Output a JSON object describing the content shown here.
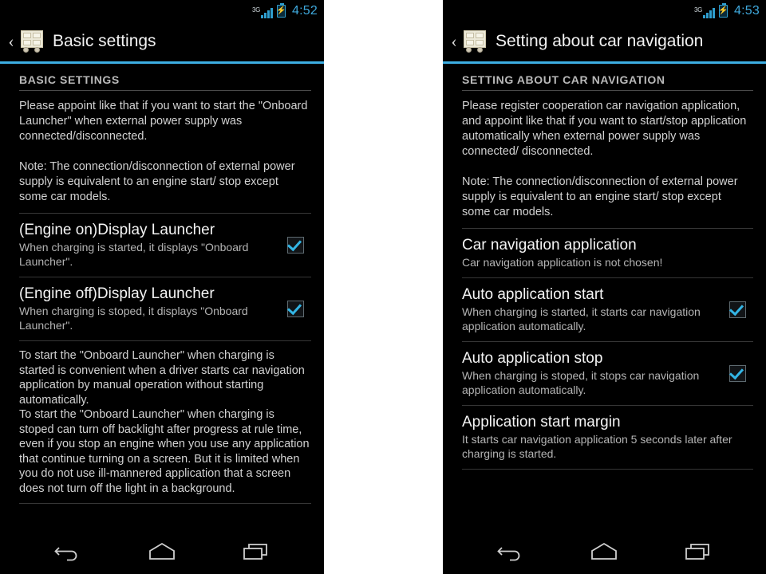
{
  "screens": [
    {
      "id": "basic-settings",
      "status_bar": {
        "network_label": "3G",
        "signal_icon": "signal-bars-icon",
        "battery_icon": "battery-charging-icon",
        "clock": "4:52"
      },
      "action_bar": {
        "up_caret": "‹",
        "app_icon": "onboard-launcher-cart-icon",
        "title": "Basic settings"
      },
      "section_header": "BASIC SETTINGS",
      "intro_paragraph": "Please appoint like that if you want to start the \"Onboard Launcher\" when external power supply was connected/disconnected.\n\nNote: The connection/disconnection of external power supply is equivalent to an engine start/ stop except some car models.",
      "preferences": [
        {
          "title": "(Engine on)Display Launcher",
          "summary": "When charging is started, it displays \"Onboard Launcher\".",
          "widget": "checkbox",
          "checked": true
        },
        {
          "title": "(Engine off)Display Launcher",
          "summary": "When charging is stoped, it displays \"Onboard Launcher\".",
          "widget": "checkbox",
          "checked": true
        }
      ],
      "footer_paragraph": "To start the \"Onboard Launcher\" when charging is started is convenient when a driver starts car navigation application by manual operation without starting automatically.\nTo start the \"Onboard Launcher\" when charging is stoped can turn off backlight after progress at rule time, even if you stop an engine when you use any application that continue turning on a screen. But it is limited when you do not use ill-mannered application that a screen does not turn off the light in a background.",
      "nav_bar": {
        "back": "back-icon",
        "home": "home-icon",
        "recents": "recent-apps-icon"
      }
    },
    {
      "id": "car-navigation-settings",
      "status_bar": {
        "network_label": "3G",
        "signal_icon": "signal-bars-icon",
        "battery_icon": "battery-charging-icon",
        "clock": "4:53"
      },
      "action_bar": {
        "up_caret": "‹",
        "app_icon": "onboard-launcher-cart-icon",
        "title": "Setting about car navigation"
      },
      "section_header": "SETTING ABOUT CAR NAVIGATION",
      "intro_paragraph": "Please register cooperation car navigation application, and appoint like that if you want to start/stop application automatically when external power supply was connected/ disconnected.\n\nNote: The connection/disconnection of external power supply is equivalent to an engine start/ stop except some car models.",
      "preferences": [
        {
          "title": "Car navigation application",
          "summary": "Car navigation application is not chosen!",
          "widget": "none",
          "checked": false
        },
        {
          "title": "Auto application start",
          "summary": "When charging is started, it starts car navigation application automatically.",
          "widget": "checkbox",
          "checked": true
        },
        {
          "title": "Auto application stop",
          "summary": "When charging is stoped, it stops car navigation application automatically.",
          "widget": "checkbox",
          "checked": true
        },
        {
          "title": "Application start margin",
          "summary": "It starts car navigation application 5 seconds later after charging is started.",
          "widget": "none",
          "checked": false
        }
      ],
      "footer_paragraph": "",
      "nav_bar": {
        "back": "back-icon",
        "home": "home-icon",
        "recents": "recent-apps-icon"
      }
    }
  ],
  "colors": {
    "accent": "#3daee3",
    "checkbox_check": "#33b5e5",
    "background": "#000000",
    "clock": "#3fa9dd",
    "title_text": "#f2f2f2",
    "summary_text": "#b4b4b4",
    "gutter": "#ffffff"
  }
}
